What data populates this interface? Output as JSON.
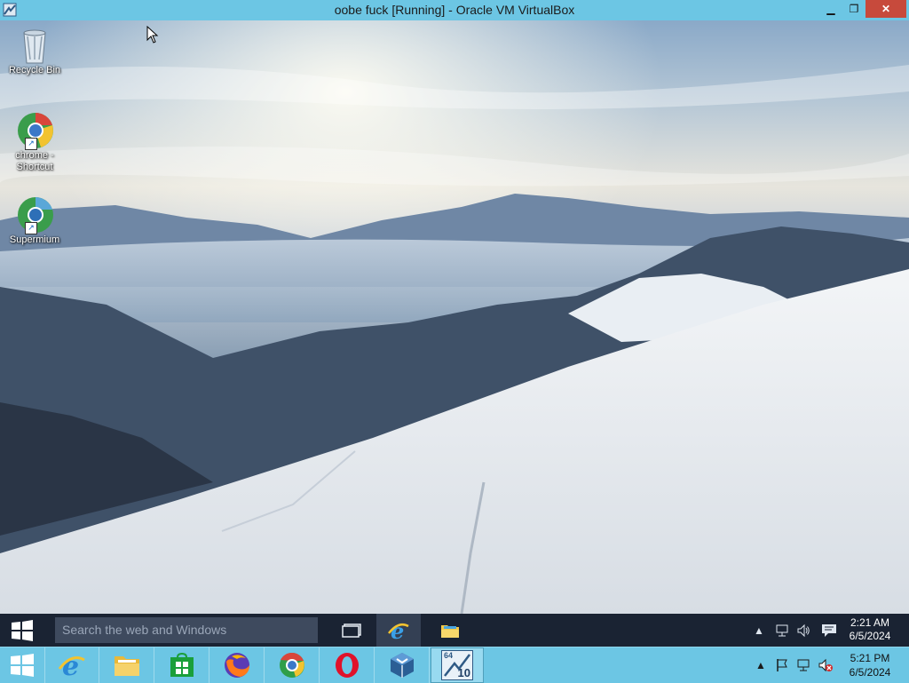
{
  "window": {
    "title": "oobe fuck [Running] - Oracle VM VirtualBox",
    "minimize_glyph": "▁",
    "restore_glyph": "❐",
    "close_glyph": "✕",
    "titlebar_color": "#6cc6e4"
  },
  "desktop": {
    "icons": [
      {
        "label": "Recycle Bin",
        "icon": "recycle-bin-icon"
      },
      {
        "label": "chrome - Shortcut",
        "icon": "chrome-icon"
      },
      {
        "label": "Supermium",
        "icon": "supermium-icon"
      }
    ]
  },
  "guest_taskbar": {
    "search_placeholder": "Search the web and Windows",
    "buttons": [
      {
        "name": "task-view-button",
        "icon": "task-view-icon"
      },
      {
        "name": "internet-explorer-button",
        "icon": "internet-explorer-icon"
      },
      {
        "name": "file-explorer-button",
        "icon": "folder-icon"
      }
    ],
    "tray": {
      "chevron": "▲",
      "time": "2:21 AM",
      "date": "6/5/2024"
    },
    "background": "#1a2333"
  },
  "host_taskbar": {
    "apps": [
      {
        "name": "Internet Explorer",
        "icon": "internet-explorer-icon"
      },
      {
        "name": "File Explorer",
        "icon": "folder-icon"
      },
      {
        "name": "Store",
        "icon": "store-icon"
      },
      {
        "name": "Firefox",
        "icon": "firefox-icon"
      },
      {
        "name": "Chrome",
        "icon": "chrome-icon"
      },
      {
        "name": "Opera",
        "icon": "opera-icon"
      },
      {
        "name": "VirtualBox",
        "icon": "virtualbox-icon"
      },
      {
        "name": "Windows 10 VM",
        "icon": "vm-win10-icon"
      }
    ],
    "vm_badge_top": "64",
    "vm_badge_bottom": "10",
    "tray": {
      "chevron": "▲",
      "time": "5:21 PM",
      "date": "6/5/2024"
    },
    "background": "#6cc6e4"
  }
}
